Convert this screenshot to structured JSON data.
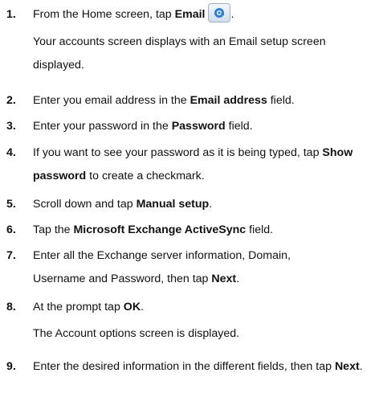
{
  "steps": [
    {
      "number": "1.",
      "pre": "From the Home screen, tap ",
      "bold": "Email",
      "icon": "email-app-icon",
      "post": ".",
      "result": "Your accounts screen displays with an Email setup screen displayed."
    },
    {
      "number": "2.",
      "pre": "Enter you email address in the ",
      "bold": "Email address",
      "post": " field."
    },
    {
      "number": "3.",
      "pre": "Enter your password in the ",
      "bold": "Password",
      "post": " field."
    },
    {
      "number": "4.",
      "pre": "If you want to see your password as it is being typed, tap ",
      "bold": "Show password",
      "post": " to create a checkmark."
    },
    {
      "number": "5.",
      "pre": "Scroll down and tap ",
      "bold": "Manual setup",
      "post": "."
    },
    {
      "number": "6.",
      "pre": "Tap the ",
      "bold": "Microsoft Exchange ActiveSync",
      "post": " field."
    },
    {
      "number": "7.",
      "pre": "Enter all the Exchange server information, Domain, Username and Password, then tap ",
      "bold": "Next",
      "post": "."
    },
    {
      "number": "8.",
      "pre": "At the prompt tap ",
      "bold": "OK",
      "post": ".",
      "result": "The Account options screen is displayed."
    },
    {
      "number": "9.",
      "pre": "Enter the desired information in the different fields, then tap ",
      "bold": "Next",
      "post": "."
    }
  ]
}
